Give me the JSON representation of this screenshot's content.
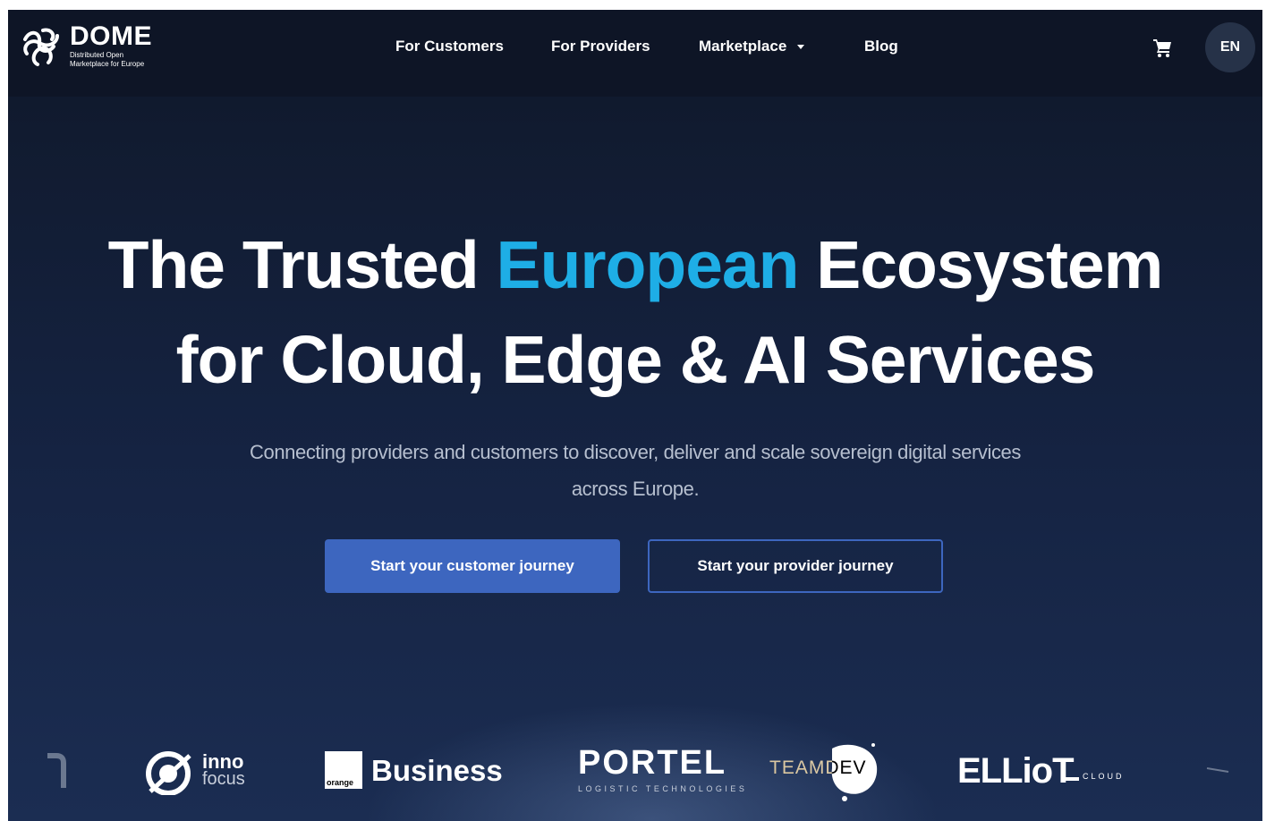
{
  "header": {
    "logo": {
      "icon": "dome-knot-icon",
      "title": "DOME",
      "subtitle_line1": "Distributed Open",
      "subtitle_line2": "Marketplace for Europe"
    },
    "nav": [
      {
        "label": "For Customers"
      },
      {
        "label": "For Providers"
      },
      {
        "label": "Marketplace",
        "icon": "chevron-down-icon"
      },
      {
        "label": "Blog"
      }
    ],
    "cart_icon": "cart-icon",
    "language": "EN"
  },
  "hero": {
    "title_part1": "The Trusted ",
    "title_accent": "European",
    "title_part2": " Ecosystem",
    "title_line2": "for Cloud, Edge & AI Services",
    "subtitle": "Connecting providers and customers to discover, deliver and scale sovereign digital services across Europe.",
    "primary_button": "Start your customer journey",
    "secondary_button": "Start your provider journey"
  },
  "partners": [
    {
      "name": "inno",
      "name2": "focus"
    },
    {
      "name": "Business",
      "badge": "orange"
    },
    {
      "name": "PORTEL",
      "tagline": "LOGISTIC TECHNOLOGIES"
    },
    {
      "name": "TEAMDEV"
    },
    {
      "name": "ELLioT",
      "tagline": "CLOUD"
    }
  ],
  "colors": {
    "accent": "#1eaee6",
    "button": "#3d66bf",
    "background": "#152342"
  }
}
